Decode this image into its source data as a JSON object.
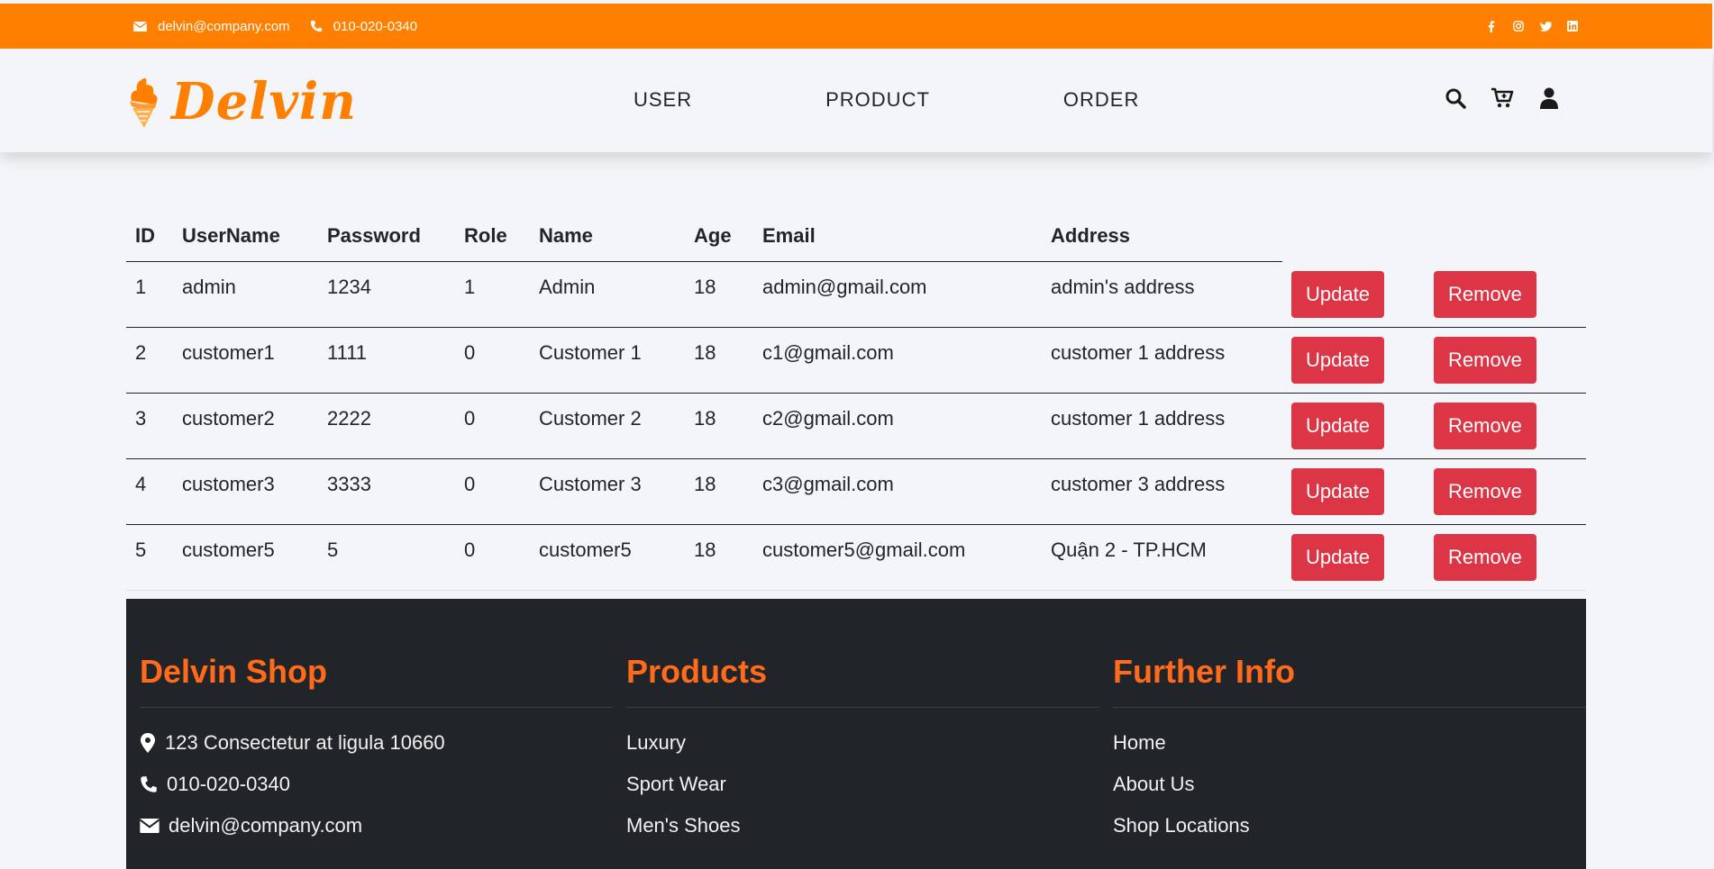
{
  "topbar": {
    "email": "delvin@company.com",
    "phone": "010-020-0340",
    "social_icons": [
      "facebook-icon",
      "instagram-icon",
      "twitter-icon",
      "linkedin-icon"
    ]
  },
  "brand": {
    "name": "Delvin"
  },
  "nav": {
    "items": [
      "USER",
      "PRODUCT",
      "ORDER"
    ]
  },
  "nav_icons": [
    "search-icon",
    "cart-icon",
    "user-icon"
  ],
  "table": {
    "headers": [
      "ID",
      "UserName",
      "Password",
      "Role",
      "Name",
      "Age",
      "Email",
      "Address"
    ],
    "rows": [
      [
        "1",
        "admin",
        "1234",
        "1",
        "Admin",
        "18",
        "admin@gmail.com",
        "admin's address"
      ],
      [
        "2",
        "customer1",
        "1111",
        "0",
        "Customer 1",
        "18",
        "c1@gmail.com",
        "customer 1 address"
      ],
      [
        "3",
        "customer2",
        "2222",
        "0",
        "Customer 2",
        "18",
        "c2@gmail.com",
        "customer 1 address"
      ],
      [
        "4",
        "customer3",
        "3333",
        "0",
        "Customer 3",
        "18",
        "c3@gmail.com",
        "customer 3 address"
      ],
      [
        "5",
        "customer5",
        "5",
        "0",
        "customer5",
        "18",
        "customer5@gmail.com",
        "Quận 2 - TP.HCM"
      ]
    ],
    "update_label": "Update",
    "remove_label": "Remove"
  },
  "footer": {
    "shop": {
      "title": "Delvin Shop",
      "address": "123 Consectetur at ligula 10660",
      "phone": "010-020-0340",
      "email": "delvin@company.com"
    },
    "products": {
      "title": "Products",
      "items": [
        "Luxury",
        "Sport Wear",
        "Men's Shoes"
      ]
    },
    "info": {
      "title": "Further Info",
      "items": [
        "Home",
        "About Us",
        "Shop Locations"
      ]
    }
  },
  "colors": {
    "accent": "#ff7f00",
    "danger": "#dc3545",
    "footer_bg": "#212529",
    "footer_title": "#ff6b1a"
  }
}
